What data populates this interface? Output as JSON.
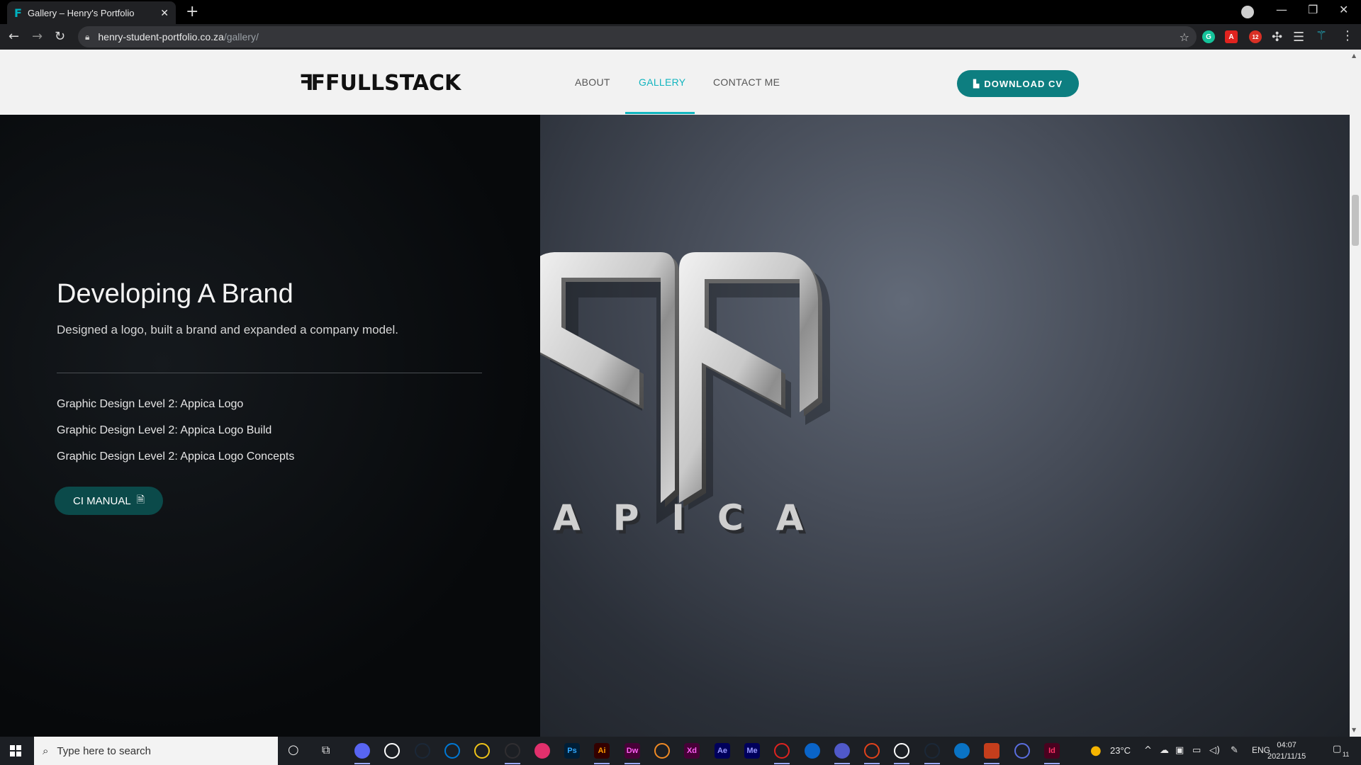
{
  "browser": {
    "tab_title": "Gallery – Henry's Portfolio",
    "tab_favicon": "F",
    "url_host": "henry-student-portfolio.co.za",
    "url_path": "/gallery/",
    "extension_badge": "12"
  },
  "site": {
    "logo": "FULLSTACK",
    "logo_mark": "ꟻF",
    "nav": [
      {
        "label": "ABOUT"
      },
      {
        "label": "GALLERY"
      },
      {
        "label": "CONTACT ME"
      }
    ],
    "cv_button": "DOWNLOAD CV",
    "accent_color": "#12b5bf",
    "button_color": "#0d7e80"
  },
  "hero": {
    "title": "Developing A Brand",
    "subtitle": "Designed a logo, built a brand and expanded a company model.",
    "projects": [
      "Graphic Design Level 2: Appica Logo",
      "Graphic Design Level 2: Appica Logo Build",
      "Graphic Design Level 2: Appica Logo Concepts"
    ],
    "ci_button": "CI MANUAL"
  },
  "showcase": {
    "brand_word": "APICA"
  },
  "taskbar": {
    "search_placeholder": "Type here to search",
    "apps": [
      {
        "name": "discord-icon",
        "label": ""
      },
      {
        "name": "chrome-icon",
        "label": ""
      },
      {
        "name": "steam-icon",
        "label": ""
      },
      {
        "name": "onedrive-icon",
        "label": ""
      },
      {
        "name": "file-explorer-icon",
        "label": ""
      },
      {
        "name": "obs-icon",
        "label": ""
      },
      {
        "name": "instagram-icon",
        "label": ""
      },
      {
        "name": "photoshop-icon",
        "label": "Ps"
      },
      {
        "name": "illustrator-icon",
        "label": "Ai"
      },
      {
        "name": "dreamweaver-icon",
        "label": "Dw"
      },
      {
        "name": "xampp-icon",
        "label": ""
      },
      {
        "name": "xd-icon",
        "label": "Xd"
      },
      {
        "name": "after-effects-icon",
        "label": "Ae"
      },
      {
        "name": "media-encoder-icon",
        "label": "Me"
      },
      {
        "name": "acrobat-icon",
        "label": ""
      },
      {
        "name": "mail-icon",
        "label": ""
      },
      {
        "name": "teams-icon",
        "label": ""
      },
      {
        "name": "office-icon",
        "label": ""
      },
      {
        "name": "chrome-active-icon",
        "label": ""
      },
      {
        "name": "steam-active-icon",
        "label": ""
      },
      {
        "name": "photos-icon",
        "label": ""
      },
      {
        "name": "powerpoint-icon",
        "label": "P"
      },
      {
        "name": "affinity-icon",
        "label": ""
      },
      {
        "name": "indesign-icon",
        "label": "Id"
      }
    ],
    "weather": "23°C",
    "language": "ENG",
    "time": "04:07",
    "date": "2021/11/15",
    "notifications": "11"
  }
}
